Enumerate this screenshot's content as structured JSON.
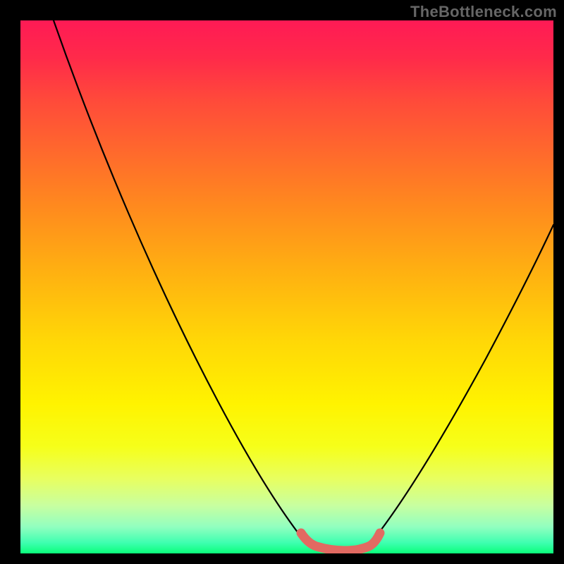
{
  "watermark": "TheBottleneck.com",
  "colors": {
    "background": "#000000",
    "curve": "#000000",
    "bump": "#e26a62",
    "gradient_top": "#ff1a55",
    "gradient_bottom": "#0aff7a"
  },
  "chart_data": {
    "type": "line",
    "title": "",
    "xlabel": "",
    "ylabel": "",
    "xlim": [
      0,
      100
    ],
    "ylim": [
      0,
      100
    ],
    "series": [
      {
        "name": "left-curve",
        "x": [
          10,
          15,
          20,
          25,
          30,
          35,
          40,
          45,
          50,
          53,
          55
        ],
        "y": [
          100,
          87,
          74,
          62,
          50,
          39,
          28,
          18,
          9,
          4,
          2
        ]
      },
      {
        "name": "right-curve",
        "x": [
          65,
          68,
          72,
          76,
          80,
          84,
          88,
          92,
          96,
          100
        ],
        "y": [
          2,
          4,
          8,
          13,
          19,
          26,
          34,
          43,
          52,
          62
        ]
      },
      {
        "name": "optimal-band",
        "x": [
          53,
          55,
          57,
          59,
          61,
          63,
          65,
          67
        ],
        "y": [
          3.0,
          1.6,
          1.0,
          0.8,
          0.8,
          1.0,
          1.6,
          3.0
        ]
      }
    ]
  }
}
